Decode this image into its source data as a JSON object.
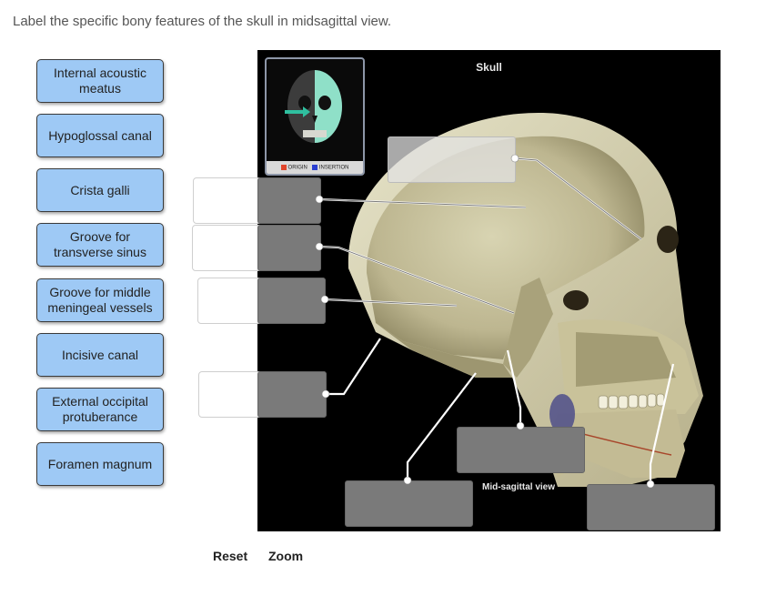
{
  "instruction": "Label the specific bony features of the skull in midsagittal view.",
  "labels": [
    "Internal acoustic\nmeatus",
    "Hypoglossal canal",
    "Crista galli",
    "Groove for\ntransverse sinus",
    "Groove for middle\nmeningeal vessels",
    "Incisive canal",
    "External occipital\nprotuberance",
    "Foramen magnum"
  ],
  "figure": {
    "title": "Skull",
    "caption": "Mid-sagittal view",
    "legend_origin": "ORIGIN",
    "legend_insertion": "INSERTION",
    "legend_origin_color": "#e0452b",
    "legend_insertion_color": "#2a3fd1"
  },
  "controls": {
    "reset": "Reset",
    "zoom": "Zoom"
  },
  "colors": {
    "chip_fill": "#9ec9f5",
    "drop_target": "#7a7a7a",
    "bone": "#cfc9a4"
  }
}
